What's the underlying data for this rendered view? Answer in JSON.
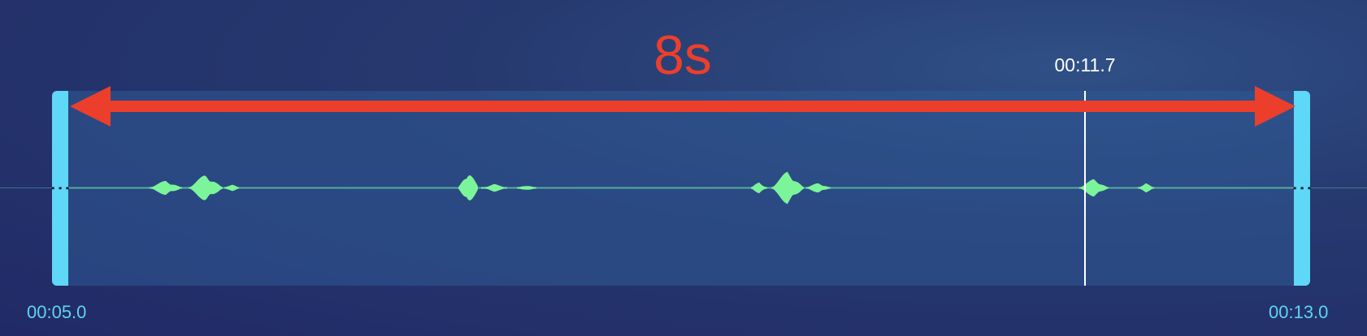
{
  "trim": {
    "duration_label": "8s",
    "start_time": "00:05.0",
    "end_time": "00:13.0",
    "playhead_time": "00:11.7"
  },
  "colors": {
    "handle": "#5fd7f7",
    "waveform": "#7cf59a",
    "annotation": "#ec3f2b",
    "time_labels": "#5fd3f3",
    "playhead": "#ffffff"
  },
  "icons": {
    "handle_grip": "vertical-ellipsis-icon",
    "duration_arrow": "double-arrow-icon"
  }
}
